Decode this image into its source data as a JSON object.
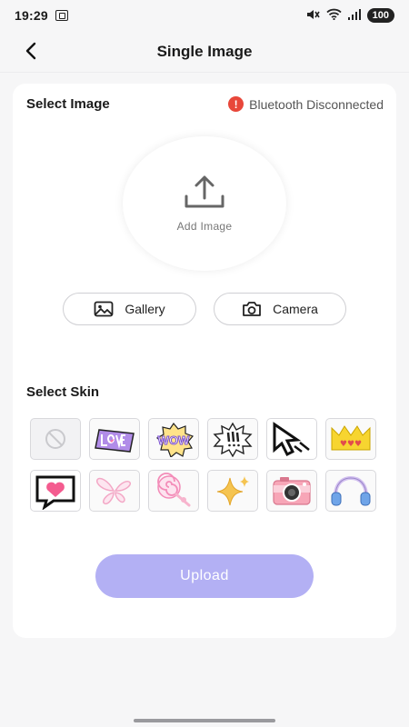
{
  "status_bar": {
    "time": "19:29",
    "battery": "100",
    "icons": [
      "screenshot-icon",
      "mute-icon",
      "wifi-icon",
      "signal-icon",
      "battery-icon"
    ]
  },
  "header": {
    "title": "Single Image",
    "back_icon": "chevron-left-icon"
  },
  "select_image": {
    "label": "Select Image",
    "bluetooth_status": "Bluetooth Disconnected",
    "bluetooth_icon": "alert-icon",
    "status_color": "#e8473a",
    "add_image_label": "Add Image",
    "upload_icon": "upload-icon"
  },
  "buttons": {
    "gallery": "Gallery",
    "camera": "Camera"
  },
  "select_skin": {
    "label": "Select Skin",
    "skins": [
      "none-icon",
      "love-sticker-icon",
      "wow-sticker-icon",
      "exclamation-sticker-icon",
      "pixel-cursor-icon",
      "yellow-crown-icon",
      "pixel-heart-bubble-icon",
      "pink-wings-icon",
      "lollipop-icon",
      "sparkle-icon",
      "pink-camera-icon",
      "headphones-icon"
    ]
  },
  "upload": {
    "label": "Upload",
    "color": "#b3b0f4"
  },
  "accent_color": "#b3b0f4"
}
